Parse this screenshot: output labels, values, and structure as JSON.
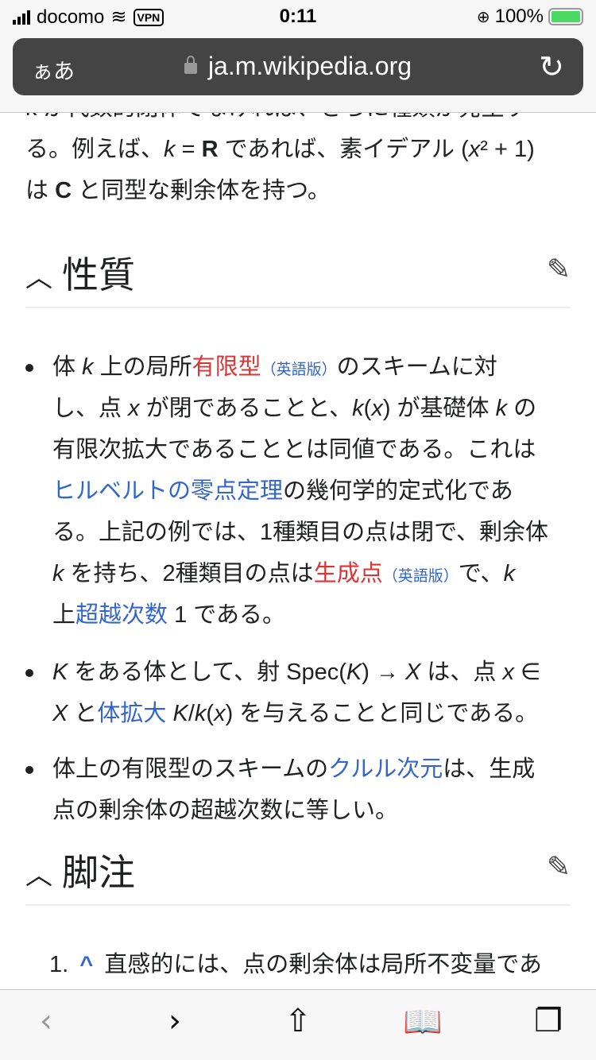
{
  "status": {
    "carrier": "docomo",
    "vpn": "VPN",
    "time": "0:11",
    "battery": "100%"
  },
  "browser": {
    "text_size": "ぁあ",
    "url": "ja.m.wikipedia.org"
  },
  "intro": {
    "lines": [
      [
        {
          "t": "k が代数的閉体でなければ、さらに種類が発生す"
        }
      ],
      [
        {
          "t": "る。例えば、"
        },
        {
          "t": "k",
          "s": "i"
        },
        {
          "t": " = "
        },
        {
          "t": "R",
          "s": "b"
        },
        {
          "t": " であれば、素イデアル ("
        },
        {
          "t": "x",
          "s": "i"
        },
        {
          "t": "²"
        },
        {
          "t": " + 1)"
        }
      ],
      [
        {
          "t": "は "
        },
        {
          "t": "C",
          "s": "b"
        },
        {
          "t": " と同型な剰余体を持つ。"
        }
      ]
    ]
  },
  "properties": {
    "title": "性質",
    "bullets": [
      {
        "lines": [
          [
            {
              "t": "体 "
            },
            {
              "t": "k",
              "s": "i"
            },
            {
              "t": " 上の局所"
            },
            {
              "t": "有限型",
              "s": "red"
            },
            {
              "t": "（英語版）",
              "s": "small"
            },
            {
              "t": "のスキームに対"
            }
          ],
          [
            {
              "t": "し、点 "
            },
            {
              "t": "x",
              "s": "i"
            },
            {
              "t": " が閉であることと、"
            },
            {
              "t": "k",
              "s": "i"
            },
            {
              "t": "("
            },
            {
              "t": "x",
              "s": "i"
            },
            {
              "t": ") が基礎体 "
            },
            {
              "t": "k",
              "s": "i"
            },
            {
              "t": " の"
            }
          ],
          [
            {
              "t": "有限次拡大であることとは同値である。これは"
            }
          ],
          [
            {
              "t": "ヒルベルトの零点定理",
              "s": "link"
            },
            {
              "t": "の幾何学的定式化であ"
            }
          ],
          [
            {
              "t": "る。上記の例では、1種類目の点は閉で、剰余体"
            }
          ],
          [
            {
              "t": "k",
              "s": "i"
            },
            {
              "t": " を持ち、2種類目の点は"
            },
            {
              "t": "生成点",
              "s": "red"
            },
            {
              "t": "（英語版）",
              "s": "small"
            },
            {
              "t": "で、"
            },
            {
              "t": "k",
              "s": "i"
            }
          ],
          [
            {
              "t": "上"
            },
            {
              "t": "超越次数",
              "s": "link"
            },
            {
              "t": " 1 である。"
            }
          ]
        ]
      },
      {
        "lines": [
          [
            {
              "t": "K",
              "s": "i"
            },
            {
              "t": " をある体として、射 Spec("
            },
            {
              "t": "K",
              "s": "i"
            },
            {
              "t": ") → "
            },
            {
              "t": "X",
              "s": "i"
            },
            {
              "t": " は、点 "
            },
            {
              "t": "x",
              "s": "i"
            },
            {
              "t": " ∈"
            }
          ],
          [
            {
              "t": "X",
              "s": "i"
            },
            {
              "t": " と"
            },
            {
              "t": "体拡大",
              "s": "link"
            },
            {
              "t": " "
            },
            {
              "t": "K",
              "s": "i"
            },
            {
              "t": "/"
            },
            {
              "t": "k",
              "s": "i"
            },
            {
              "t": "("
            },
            {
              "t": "x",
              "s": "i"
            },
            {
              "t": ") を与えることと同じである。"
            }
          ]
        ]
      },
      {
        "lines": [
          [
            {
              "t": "体上の有限型のスキームの"
            },
            {
              "t": "クルル次元",
              "s": "link"
            },
            {
              "t": "は、生成"
            }
          ],
          [
            {
              "t": "点の剰余体の超越次数に等しい。"
            }
          ]
        ]
      }
    ]
  },
  "footnotes": {
    "title": "脚注",
    "items": [
      {
        "number": "1.",
        "caret": "^",
        "text": "直感的には、点の剰余体は局所不変量であ"
      }
    ]
  },
  "colors": {
    "link": "#3366cc",
    "redlink": "#dd3333",
    "urlbar": "#444444"
  }
}
